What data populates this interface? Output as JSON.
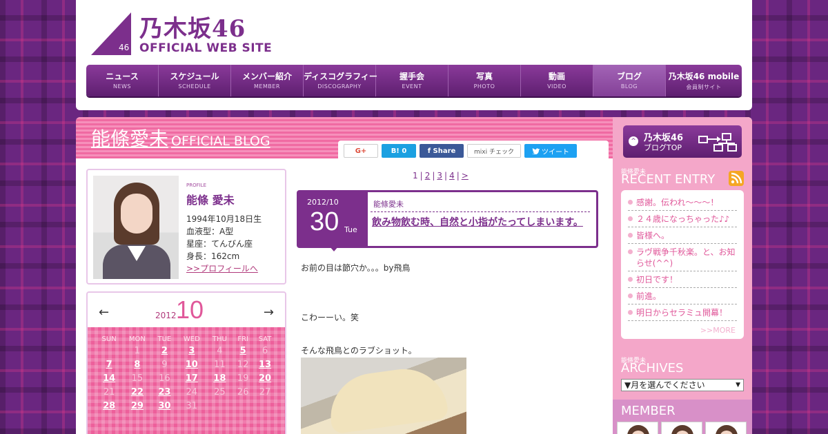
{
  "header": {
    "logo_jp": "乃木坂46",
    "logo_en": "OFFICIAL WEB SITE",
    "logo_num": "46"
  },
  "nav": [
    {
      "jp": "ニュース",
      "en": "NEWS"
    },
    {
      "jp": "スケジュール",
      "en": "SCHEDULE"
    },
    {
      "jp": "メンバー紹介",
      "en": "MEMBER"
    },
    {
      "jp": "ディスコグラフィー",
      "en": "DISCOGRAPHY"
    },
    {
      "jp": "握手会",
      "en": "EVENT"
    },
    {
      "jp": "写真",
      "en": "PHOTO"
    },
    {
      "jp": "動画",
      "en": "VIDEO"
    },
    {
      "jp": "ブログ",
      "en": "BLOG"
    },
    {
      "jp": "乃木坂46 mobile",
      "en": "会員制サイト"
    }
  ],
  "blog_head": {
    "name": "能條愛未",
    "sub": "OFFICIAL BLOG"
  },
  "share": {
    "google": "G+",
    "hatena": "B! 0",
    "facebook": "f Share",
    "mixi": "mixi チェック",
    "twitter": "ツイート"
  },
  "profile": {
    "label": "PROFILE",
    "name": "能條 愛未",
    "birthday": "1994年10月18日生",
    "blood": "血液型：A型",
    "sign": "星座：てんびん座",
    "height": "身長：162cm",
    "more": ">>プロフィールへ"
  },
  "calendar": {
    "prev": "←",
    "next": "→",
    "year": "2012",
    "month": "10",
    "weekdays": [
      "SUN",
      "MON",
      "TUE",
      "WED",
      "THU",
      "FRI",
      "SAT"
    ],
    "weeks": [
      [
        {
          "d": ""
        },
        {
          "d": "1"
        },
        {
          "d": "2",
          "link": true
        },
        {
          "d": "3",
          "link": true
        },
        {
          "d": "4"
        },
        {
          "d": "5",
          "link": true
        },
        {
          "d": "6"
        }
      ],
      [
        {
          "d": "7",
          "link": true
        },
        {
          "d": "8",
          "link": true
        },
        {
          "d": "9"
        },
        {
          "d": "10",
          "link": true
        },
        {
          "d": "11"
        },
        {
          "d": "12"
        },
        {
          "d": "13",
          "link": true
        }
      ],
      [
        {
          "d": "14",
          "link": true
        },
        {
          "d": "15"
        },
        {
          "d": "16"
        },
        {
          "d": "17",
          "link": true
        },
        {
          "d": "18",
          "link": true
        },
        {
          "d": "19"
        },
        {
          "d": "20",
          "link": true
        }
      ],
      [
        {
          "d": "21"
        },
        {
          "d": "22",
          "link": true
        },
        {
          "d": "23",
          "link": true
        },
        {
          "d": "24"
        },
        {
          "d": "25"
        },
        {
          "d": "26"
        },
        {
          "d": "27"
        }
      ],
      [
        {
          "d": "28",
          "link": true
        },
        {
          "d": "29",
          "link": true
        },
        {
          "d": "30",
          "link": true
        },
        {
          "d": "31"
        },
        {
          "d": ""
        },
        {
          "d": ""
        },
        {
          "d": ""
        }
      ]
    ]
  },
  "pager": {
    "current": "1",
    "pages": [
      "2",
      "3",
      "4"
    ],
    "next": ">"
  },
  "entry": {
    "year_month": "2012/10",
    "day": "30",
    "dow": "Tue",
    "author": "能條愛未",
    "title": "飲み物飲む時、自然と小指がたってしまいます。",
    "body": [
      "お前の目は節穴か。。。by飛鳥",
      "こわーーい。笑",
      "そんな飛鳥とのラブショット。"
    ]
  },
  "sidebar": {
    "blog_top_1": "乃木坂46",
    "blog_top_2": "ブログTOP",
    "recent_label": "能條愛未",
    "recent_title": "RECENT ENTRY",
    "recent": [
      "感謝。伝われ〜〜〜！",
      "２４歳になっちゃった♪♪",
      "皆様へ。",
      "ラヴ戦争千秋楽。と、お知らせ(^^)",
      "初日です！",
      "前進。",
      "明日からセラミュ開幕！"
    ],
    "more": ">>MORE",
    "archives_label": "能條愛未",
    "archives_title": "ARCHIVES",
    "archives_select": "▼月を選んでください",
    "member_title": "MEMBER"
  },
  "colors": {
    "brand_purple": "#7c2f8c",
    "pink": "#ed5f9b",
    "sidebar_pink": "#f4a7c9"
  }
}
